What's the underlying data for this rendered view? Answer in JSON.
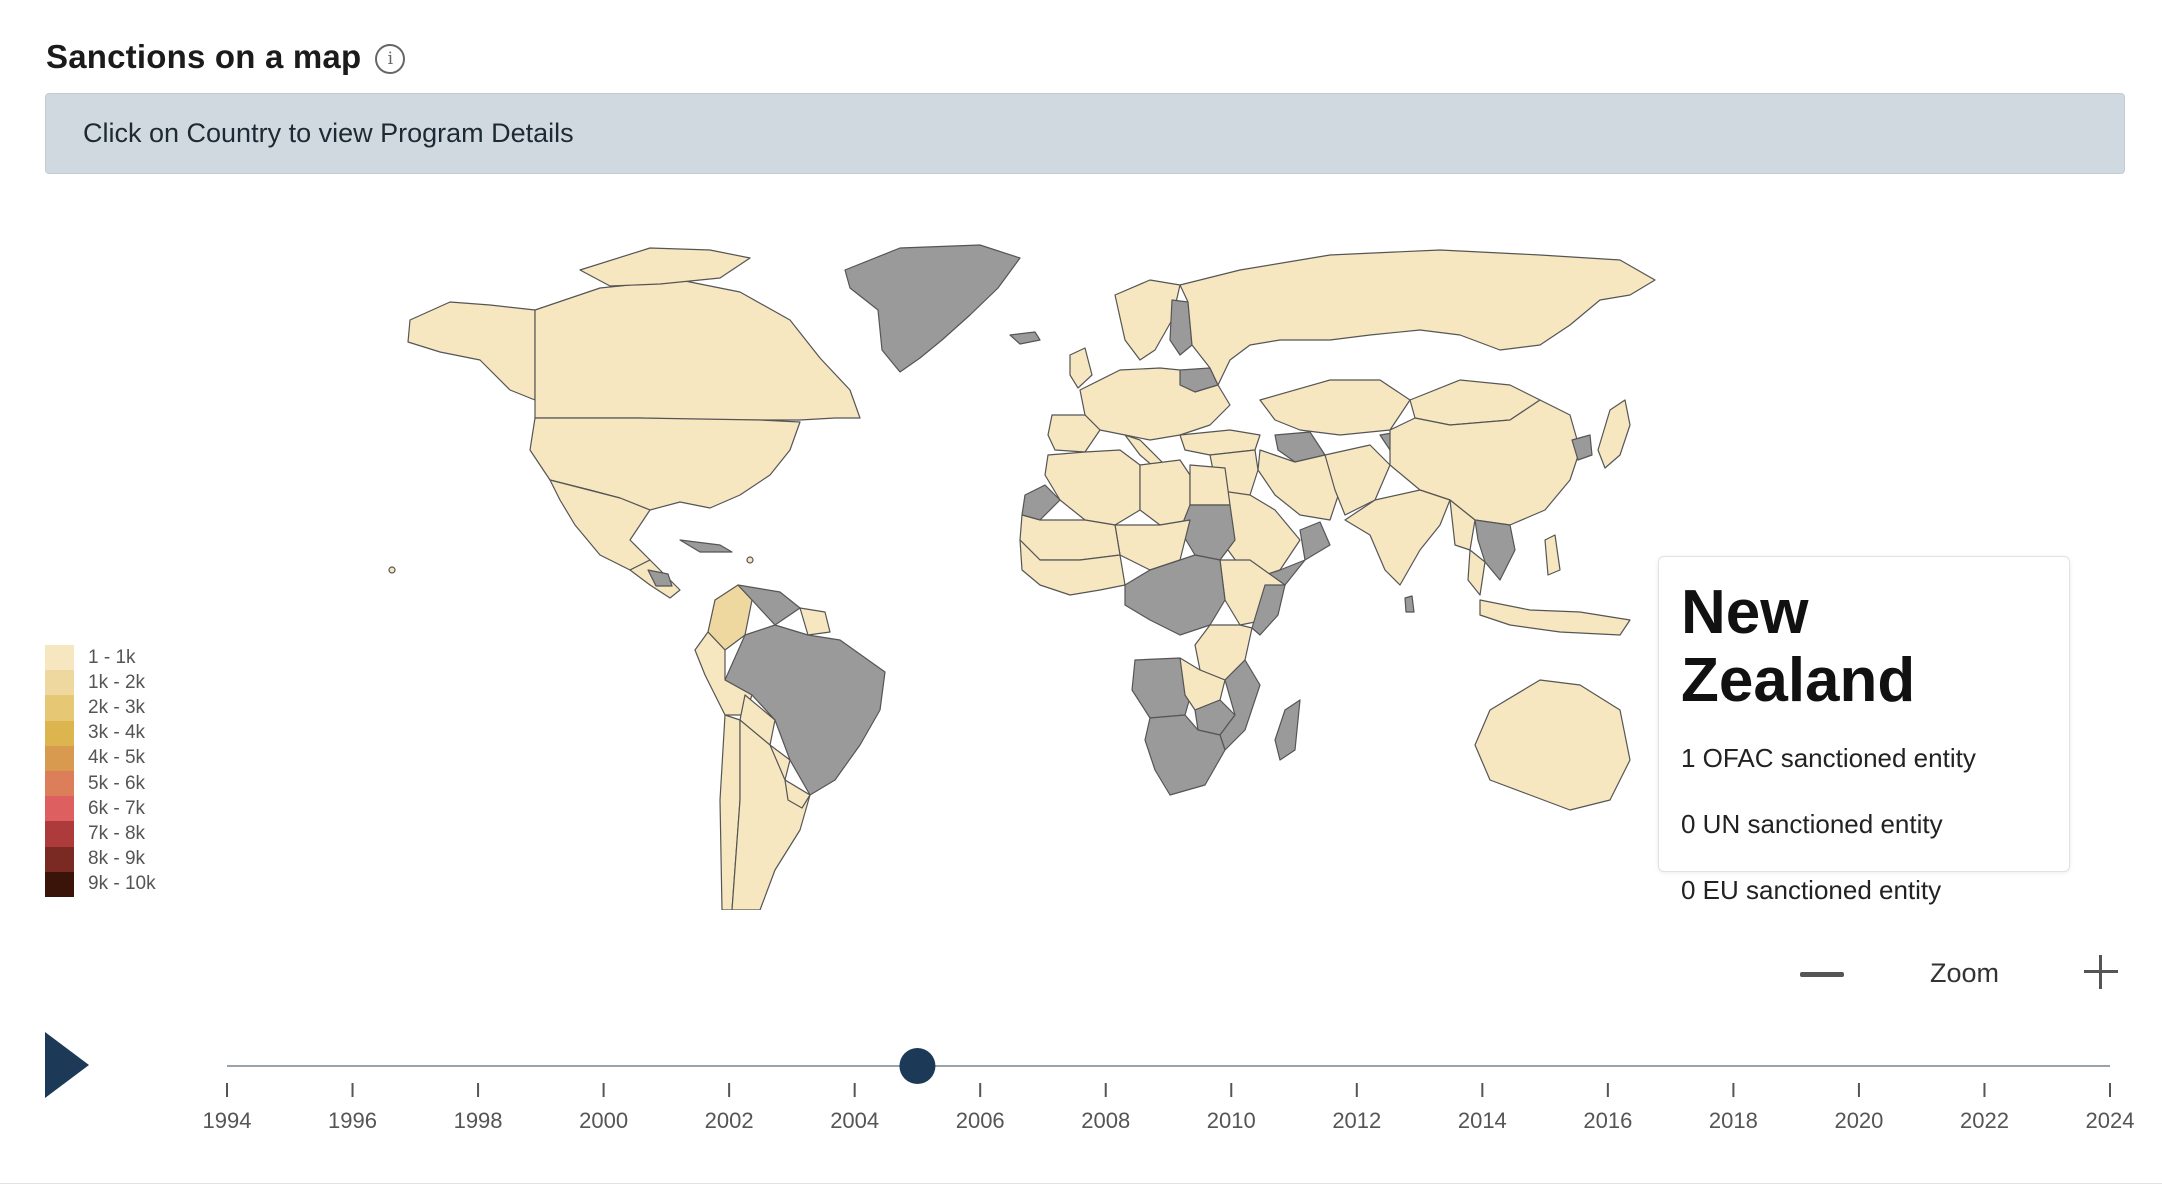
{
  "header": {
    "title": "Sanctions on a map",
    "info_icon": "info-icon"
  },
  "banner": {
    "text": "Click on Country to view Program Details"
  },
  "legend": {
    "items": [
      {
        "label": "1 - 1k",
        "color": "#f6e7c1"
      },
      {
        "label": "1k - 2k",
        "color": "#efd8a0"
      },
      {
        "label": "2k - 3k",
        "color": "#e6c774"
      },
      {
        "label": "3k - 4k",
        "color": "#dcb54f"
      },
      {
        "label": "4k - 5k",
        "color": "#d89a4f"
      },
      {
        "label": "5k - 6k",
        "color": "#dc7e5a"
      },
      {
        "label": "6k - 7k",
        "color": "#de5f5f"
      },
      {
        "label": "7k - 8k",
        "color": "#ae3b3b"
      },
      {
        "label": "8k - 9k",
        "color": "#7a2a22"
      },
      {
        "label": "9k - 10k",
        "color": "#3a1408"
      }
    ]
  },
  "map": {
    "no_data_color": "#9a9a9a",
    "border_color": "#555555"
  },
  "tooltip": {
    "country": "New Zealand",
    "lines": [
      "1 OFAC sanctioned entity",
      "0 UN sanctioned entity",
      "0 EU sanctioned entity"
    ]
  },
  "zoom": {
    "label": "Zoom",
    "minus_icon": "minus-icon",
    "plus_icon": "plus-icon"
  },
  "player": {
    "play_icon": "play-icon",
    "selected_year": 2005,
    "min_year": 1994,
    "max_year": 2024
  },
  "timeline": {
    "ticks": [
      "1994",
      "1996",
      "1998",
      "2000",
      "2002",
      "2004",
      "2006",
      "2008",
      "2010",
      "2012",
      "2014",
      "2016",
      "2018",
      "2020",
      "2022",
      "2024"
    ],
    "accent": "#1c3a57"
  }
}
